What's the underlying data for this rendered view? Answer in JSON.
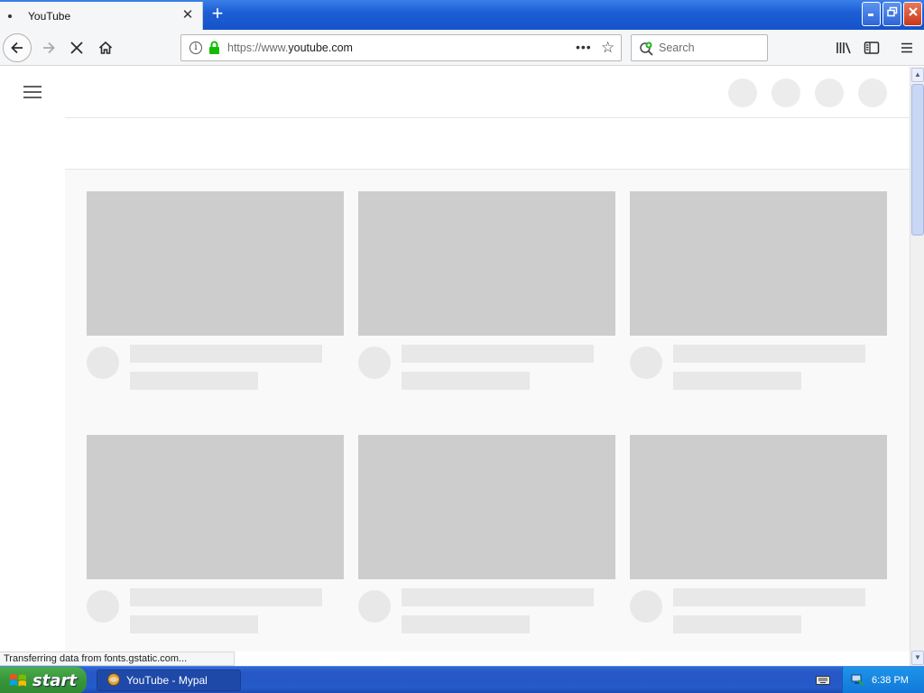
{
  "browser": {
    "tab": {
      "title": "YouTube"
    },
    "address": {
      "url_prefix": "https://www.",
      "url_domain": "youtube.com"
    },
    "search": {
      "placeholder": "Search"
    },
    "status_text": "Transferring data from fonts.gstatic.com..."
  },
  "taskbar": {
    "start_label": "start",
    "window_item": "YouTube - Mypal",
    "clock": "6:38 PM"
  },
  "colors": {
    "skeleton_thumb": "#cdcdcd",
    "skeleton_line": "#e8e8e8",
    "grid_background": "#f9f9f9",
    "taskbar_blue": "#245ac9",
    "start_green": "#37953a"
  },
  "page": {
    "video_grid": {
      "rows": 2,
      "columns": 3,
      "loading": true
    }
  }
}
